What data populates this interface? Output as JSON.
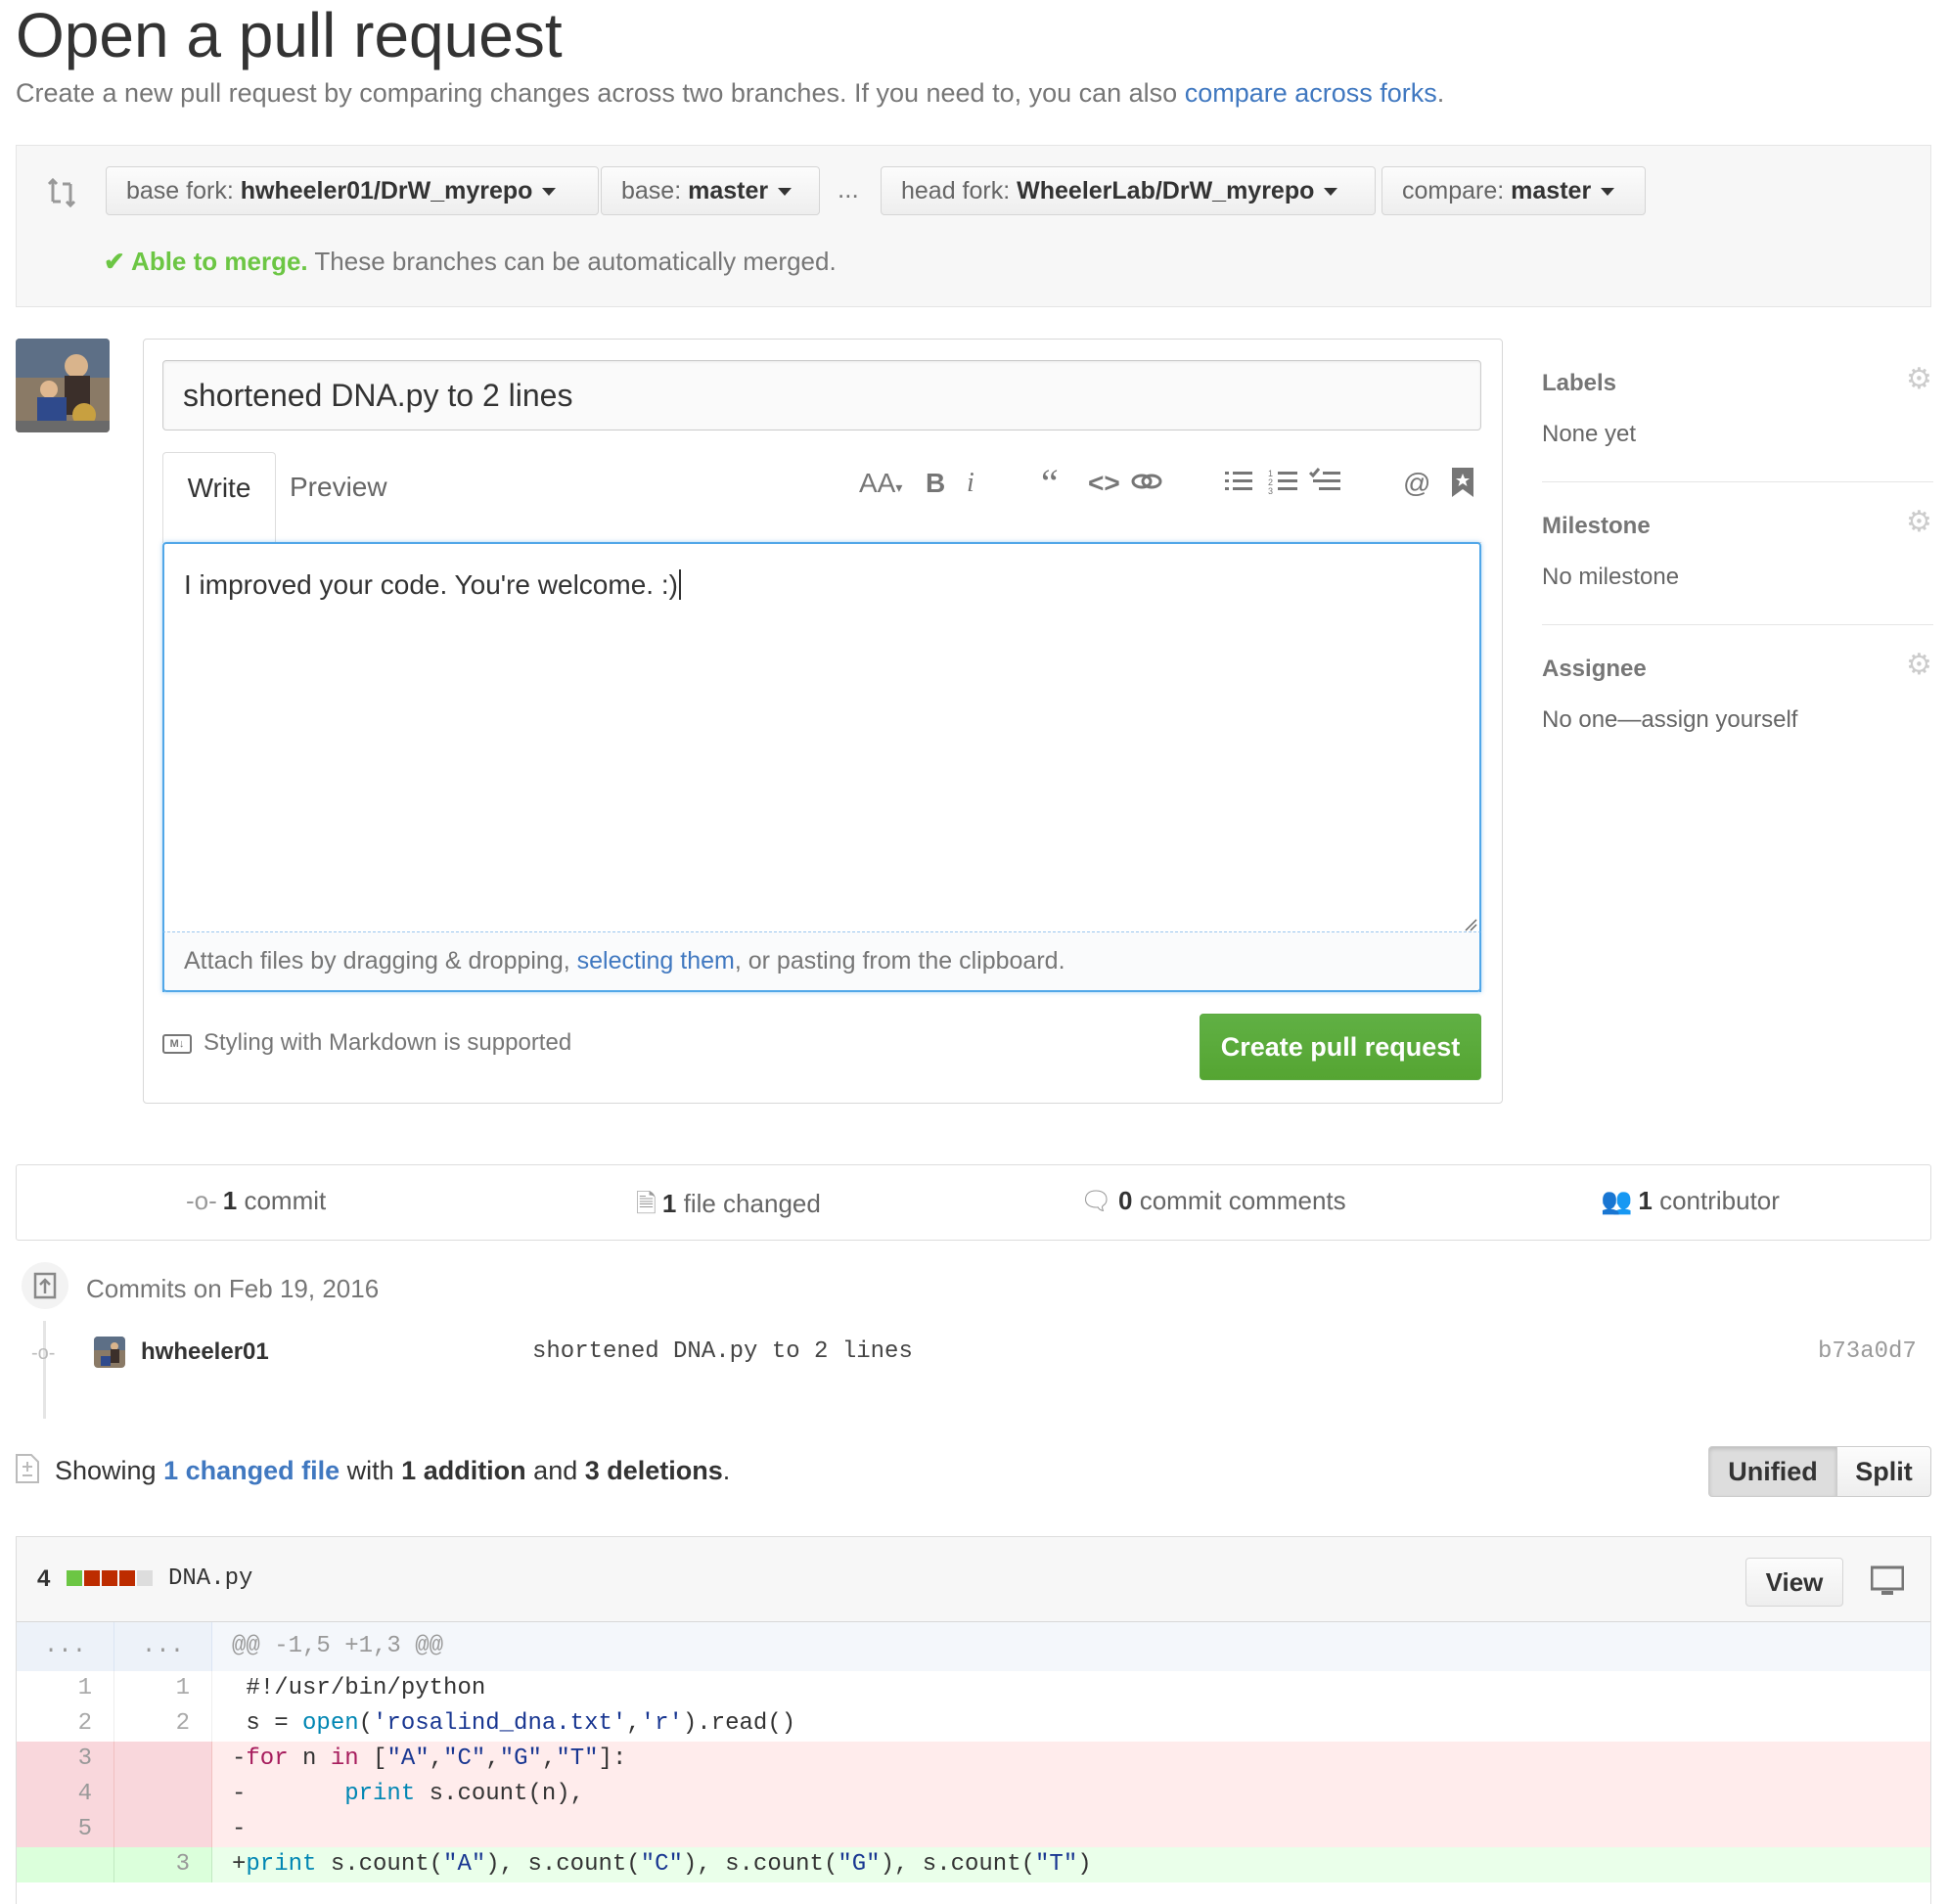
{
  "header": {
    "title": "Open a pull request",
    "subtitle": "Create a new pull request by comparing changes across two branches. If you need to, you can also ",
    "compare_link": "compare across forks",
    "subtitle_end": "."
  },
  "range": {
    "base_fork_label": "base fork: ",
    "base_fork_value": "hwheeler01/DrW_myrepo",
    "base_label": "base: ",
    "base_value": "master",
    "dots": "...",
    "head_fork_label": "head fork: ",
    "head_fork_value": "WheelerLab/DrW_myrepo",
    "compare_label": "compare: ",
    "compare_value": "master",
    "merge_ok": "Able to merge.",
    "merge_text": " These branches can be automatically merged."
  },
  "form": {
    "title_value": "shortened DNA.py to 2 lines",
    "tab_write": "Write",
    "tab_preview": "Preview",
    "body_value": "I improved your code. You're welcome. :)",
    "attach_prefix": "Attach files by dragging & dropping, ",
    "attach_link": "selecting them",
    "attach_suffix": ", or pasting from the clipboard.",
    "markdown_badge": "M↓",
    "markdown_note": "Styling with Markdown is supported",
    "create_button": "Create pull request",
    "toolbar": {
      "text_size": "AA",
      "bold": "B",
      "italic": "i",
      "quote": "“",
      "code": "<>",
      "mention": "@"
    }
  },
  "sidebar": {
    "labels_title": "Labels",
    "labels_value": "None yet",
    "milestone_title": "Milestone",
    "milestone_value": "No milestone",
    "assignee_title": "Assignee",
    "assignee_value": "No one—assign yourself"
  },
  "summary": {
    "commits_count": "1",
    "commits_label": " commit",
    "files_count": "1",
    "files_label": " file changed",
    "comments_count": "0",
    "comments_label": " commit comments",
    "contributors_count": "1",
    "contributors_label": " contributor"
  },
  "commits": {
    "date_heading": "Commits on Feb 19, 2016",
    "items": [
      {
        "author": "hwheeler01",
        "message": "shortened DNA.py to 2 lines",
        "sha": "b73a0d7"
      }
    ]
  },
  "diff_summary": {
    "showing": "Showing ",
    "changed_link": "1 changed file",
    "with": " with ",
    "additions": "1 addition",
    "and": " and ",
    "deletions": "3 deletions",
    "end": ".",
    "unified_label": "Unified",
    "split_label": "Split"
  },
  "file": {
    "change_count": "4",
    "name": "DNA.py",
    "view_button": "View",
    "hunk_left": "...",
    "hunk_right": "...",
    "hunk_header": "@@ -1,5 +1,3 @@",
    "lines": [
      {
        "old": "1",
        "new": "1",
        "type": "context"
      },
      {
        "old": "2",
        "new": "2",
        "type": "context"
      },
      {
        "old": "3",
        "new": "",
        "type": "deletion"
      },
      {
        "old": "4",
        "new": "",
        "type": "deletion"
      },
      {
        "old": "5",
        "new": "",
        "type": "deletion"
      },
      {
        "old": "",
        "new": "3",
        "type": "addition"
      }
    ],
    "code_tokens": {
      "l1": " #!/usr/bin/python",
      "l2_a": " s = ",
      "l2_open": "open",
      "l2_b": "(",
      "l2_s1": "'rosalind_dna.txt'",
      "l2_c": ",",
      "l2_s2": "'r'",
      "l2_d": ").read()",
      "l3_minus": "-",
      "l3_for": "for",
      "l3_n": " n ",
      "l3_in": "in",
      "l3_b": " [",
      "l3_sa": "\"A\"",
      "l3_sc": "\"C\"",
      "l3_sg": "\"G\"",
      "l3_st": "\"T\"",
      "l3_end": "]:",
      "comma": ",",
      "l4_a": "-       ",
      "l4_print": "print",
      "l4_b": " s.count(n),",
      "l5": "-",
      "l6_plus": "+",
      "l6_print": "print",
      "l6_a": " s.count(",
      "l6_b": "), s.count(",
      "l6_c": "), s.count(",
      "l6_d": "), s.count(",
      "l6_e": ")"
    }
  },
  "colors": {
    "link": "#4078c0",
    "merge_ok": "#6cc644",
    "create_button": "#55a532",
    "deletion_bg": "#ffecec",
    "deletion_num_bg": "#f9d7dc",
    "addition_bg": "#eaffea",
    "addition_num_bg": "#dbffdb",
    "hunk_bg": "#f4f7fb"
  }
}
